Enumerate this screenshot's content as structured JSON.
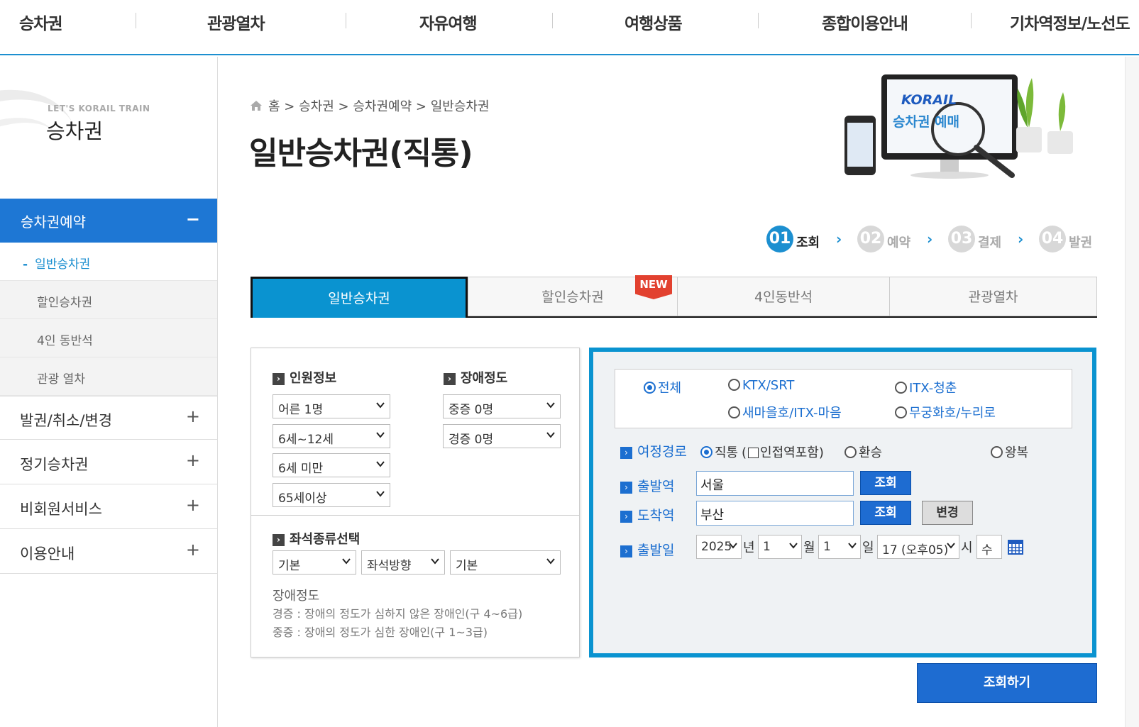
{
  "top_nav": [
    "승차권",
    "관광열차",
    "자유여행",
    "여행상품",
    "종합이용안내",
    "기차역정보/노선도"
  ],
  "sidebar": {
    "eyebrow": "LET'S KORAIL TRAIN",
    "title": "승차권",
    "active_menu": {
      "label": "승차권예약",
      "sign": "−"
    },
    "submenu": [
      {
        "label": "일반승차권",
        "active": true
      },
      {
        "label": "할인승차권",
        "active": false
      },
      {
        "label": "4인 동반석",
        "active": false
      },
      {
        "label": "관광 열차",
        "active": false
      }
    ],
    "menus": [
      {
        "label": "발권/취소/변경",
        "sign": "+"
      },
      {
        "label": "정기승차권",
        "sign": "+"
      },
      {
        "label": "비회원서비스",
        "sign": "+"
      },
      {
        "label": "이용안내",
        "sign": "+"
      }
    ]
  },
  "breadcrumb": [
    "홈",
    "승차권",
    "승차권예약",
    "일반승차권"
  ],
  "breadcrumb_sep": ">",
  "page_title": "일반승차권(직통)",
  "promo": {
    "brand": "KORAIL",
    "text": "승차권 예매"
  },
  "steps": [
    {
      "num": "01",
      "label": "조회",
      "active": true
    },
    {
      "num": "02",
      "label": "예약",
      "active": false
    },
    {
      "num": "03",
      "label": "결제",
      "active": false
    },
    {
      "num": "04",
      "label": "발권",
      "active": false
    }
  ],
  "tabs": [
    {
      "label": "일반승차권",
      "active": true
    },
    {
      "label": "할인승차권",
      "active": false
    },
    {
      "label": "4인동반석",
      "active": false
    },
    {
      "label": "관광열차",
      "active": false
    }
  ],
  "new_badge": "NEW",
  "passengers": {
    "heading": "인원정보",
    "adult": "어른 1명",
    "child": "6세~12세",
    "infant": "6세 미만",
    "senior": "65세이상"
  },
  "disability": {
    "heading": "장애정도",
    "severe": "중증 0명",
    "mild": "경증 0명"
  },
  "seat": {
    "heading": "좌석종류선택",
    "type": "기본",
    "direction": "좌석방향",
    "option": "기본"
  },
  "notes": {
    "heading": "장애정도",
    "mild": "경증 : 장애의 정도가 심하지 않은 장애인(구 4~6급)",
    "severe": "중증 : 장애의 정도가 심한 장애인(구 1~3급)"
  },
  "train_types": [
    {
      "label": "전체",
      "checked": true
    },
    {
      "label": "KTX/SRT",
      "checked": false
    },
    {
      "label": "ITX-청춘",
      "checked": false
    },
    {
      "label": "새마을호/ITX-마음",
      "checked": false
    },
    {
      "label": "무궁화호/누리로",
      "checked": false
    }
  ],
  "route": {
    "label": "여정경로",
    "direct": "직통",
    "adjacent": "인접역포함",
    "transfer": "환승",
    "roundtrip": "왕복",
    "selected": "직통"
  },
  "departure": {
    "label": "출발역",
    "value": "서울",
    "button": "조회"
  },
  "arrival": {
    "label": "도착역",
    "value": "부산",
    "button": "조회",
    "swap_button": "변경"
  },
  "date": {
    "label": "출발일",
    "year": "2025",
    "year_unit": "년",
    "month": "1",
    "month_unit": "월",
    "day": "1",
    "day_unit": "일",
    "hour": "17 (오후05)",
    "hour_unit": "시",
    "weekday": "수"
  },
  "search_button": "조회하기",
  "colors": {
    "primary": "#1c8fd0",
    "tab_active": "#0a93d0",
    "button": "#1e6cd1",
    "badge": "#e2412f",
    "panel_bg": "#eff2f4"
  }
}
